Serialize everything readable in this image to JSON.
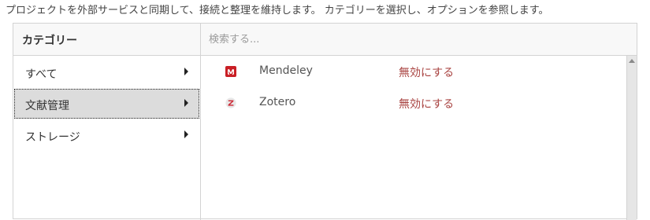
{
  "intro_text": "プロジェクトを外部サービスと同期して、接続と整理を維持します。 カテゴリーを選択し、オプションを参照します。",
  "categories_header": "カテゴリー",
  "search": {
    "placeholder": "検索する..."
  },
  "sidebar": {
    "items": [
      {
        "label": "すべて",
        "active": false
      },
      {
        "label": "文献管理",
        "active": true
      },
      {
        "label": "ストレージ",
        "active": false
      }
    ]
  },
  "services": [
    {
      "name": "Mendeley",
      "action": "無効にする",
      "icon": "mendeley-icon",
      "icon_color": "#c91f25"
    },
    {
      "name": "Zotero",
      "action": "無効にする",
      "icon": "zotero-icon",
      "icon_color": "#cc2936"
    }
  ],
  "colors": {
    "link": "#a94442",
    "active_bg": "#dcdcdc",
    "header_bg": "#f8f8f8"
  }
}
